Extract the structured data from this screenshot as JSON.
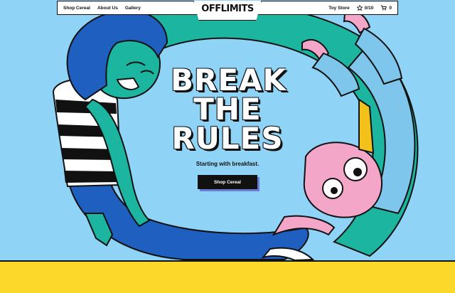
{
  "nav": {
    "links": [
      "Shop Cereal",
      "About Us",
      "Gallery"
    ],
    "logo": "OFFLIMITS",
    "toy_store": "Toy Store",
    "points": "0/10",
    "cart_count": "0"
  },
  "hero": {
    "title_lines": [
      "BREAK",
      "THE",
      "RULES"
    ],
    "subtitle": "Starting with breakfast.",
    "cta_label": "Shop Cereal"
  },
  "colors": {
    "background": "#8fd3f7",
    "band": "#fbd829",
    "character_skin": "#1bb5a0",
    "hair": "#1f5fbf",
    "bunny": "#f4a6c8"
  },
  "icons": [
    "star-icon",
    "cart-icon"
  ]
}
